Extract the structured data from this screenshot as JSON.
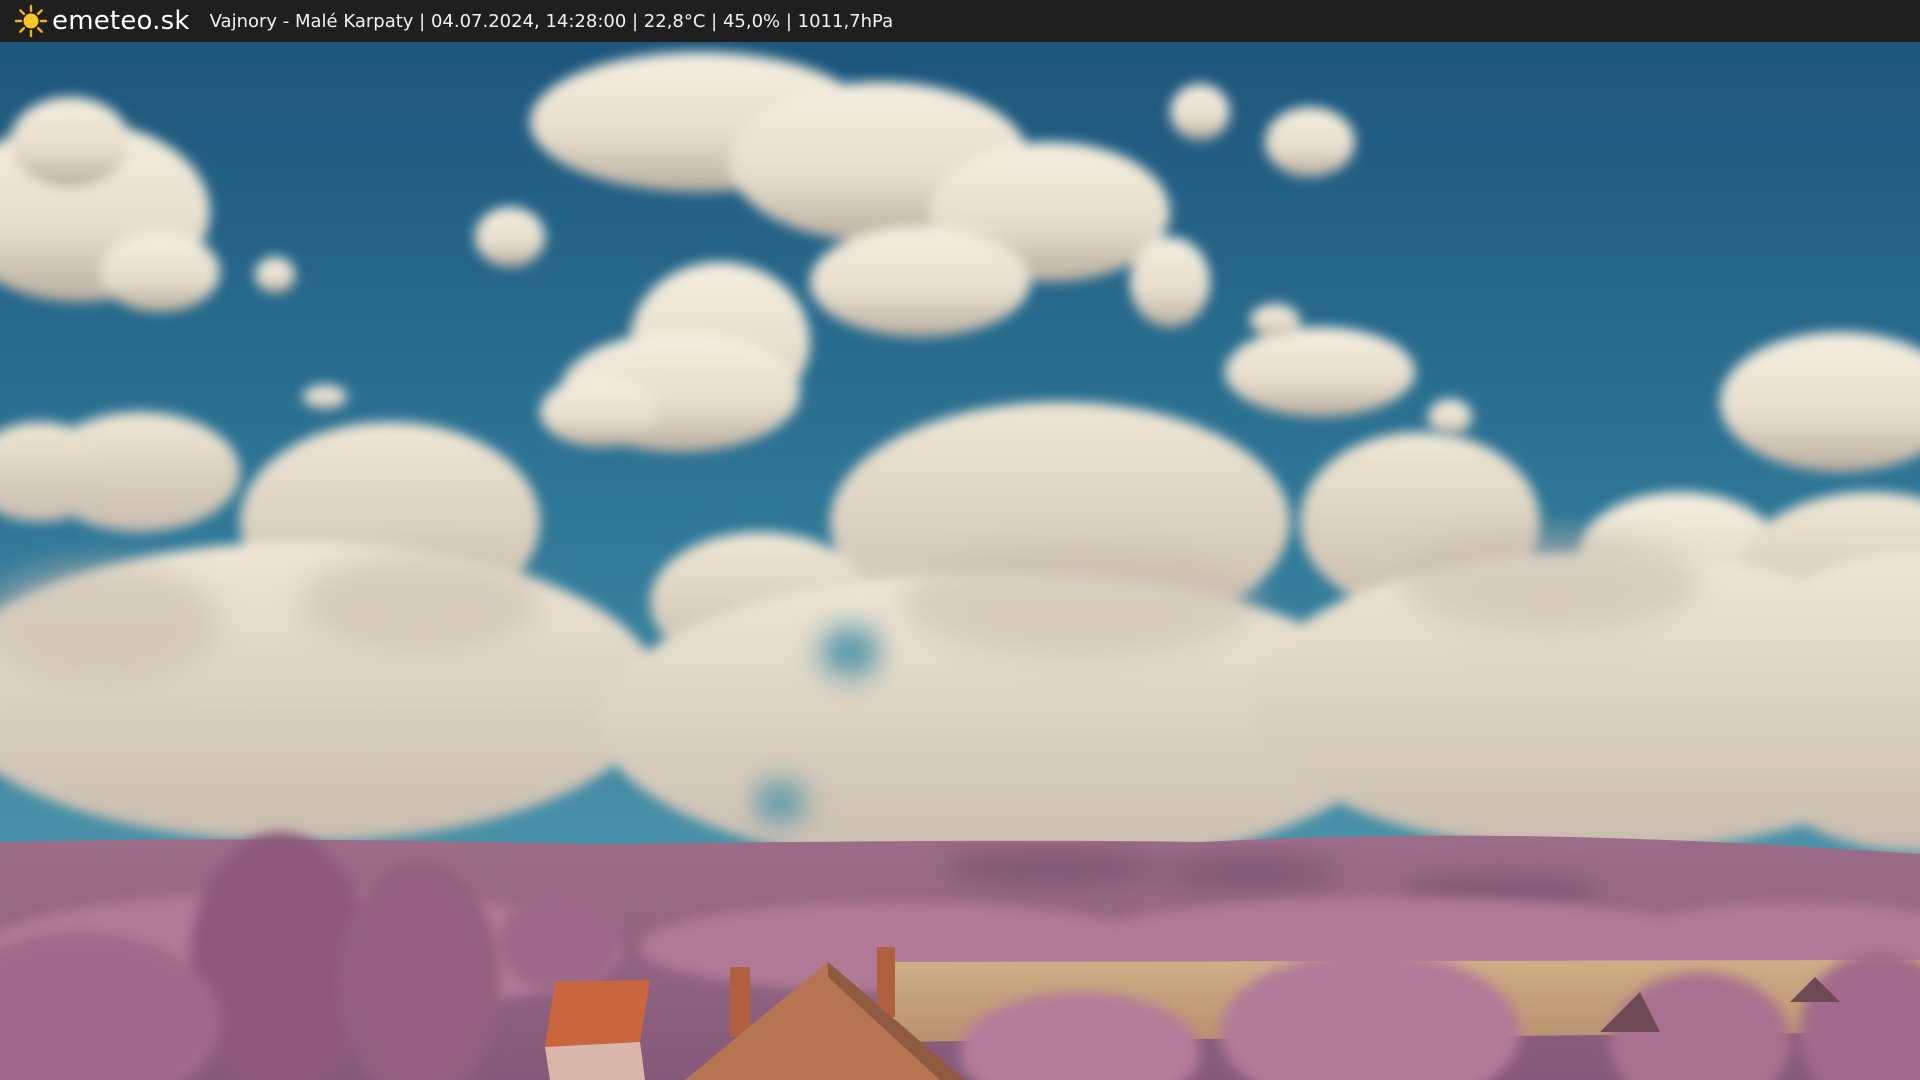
{
  "header": {
    "logo_icon": "sun-icon",
    "brand": "emeteo.sk",
    "caption": "Vajnory - Malé Karpaty | 04.07.2024, 14:28:00 | 22,8°C | 45,0% | 1011,7hPa"
  },
  "colors": {
    "sky_top": "#1f5b80",
    "sky_bottom": "#3e8aa6",
    "cloud": "#ece6d4",
    "cloud_shadow": "#bfb3a6",
    "hills": "#9a6a87",
    "foliage": "#a9728f",
    "field": "#c6a37f",
    "roof": "#c9663e"
  }
}
